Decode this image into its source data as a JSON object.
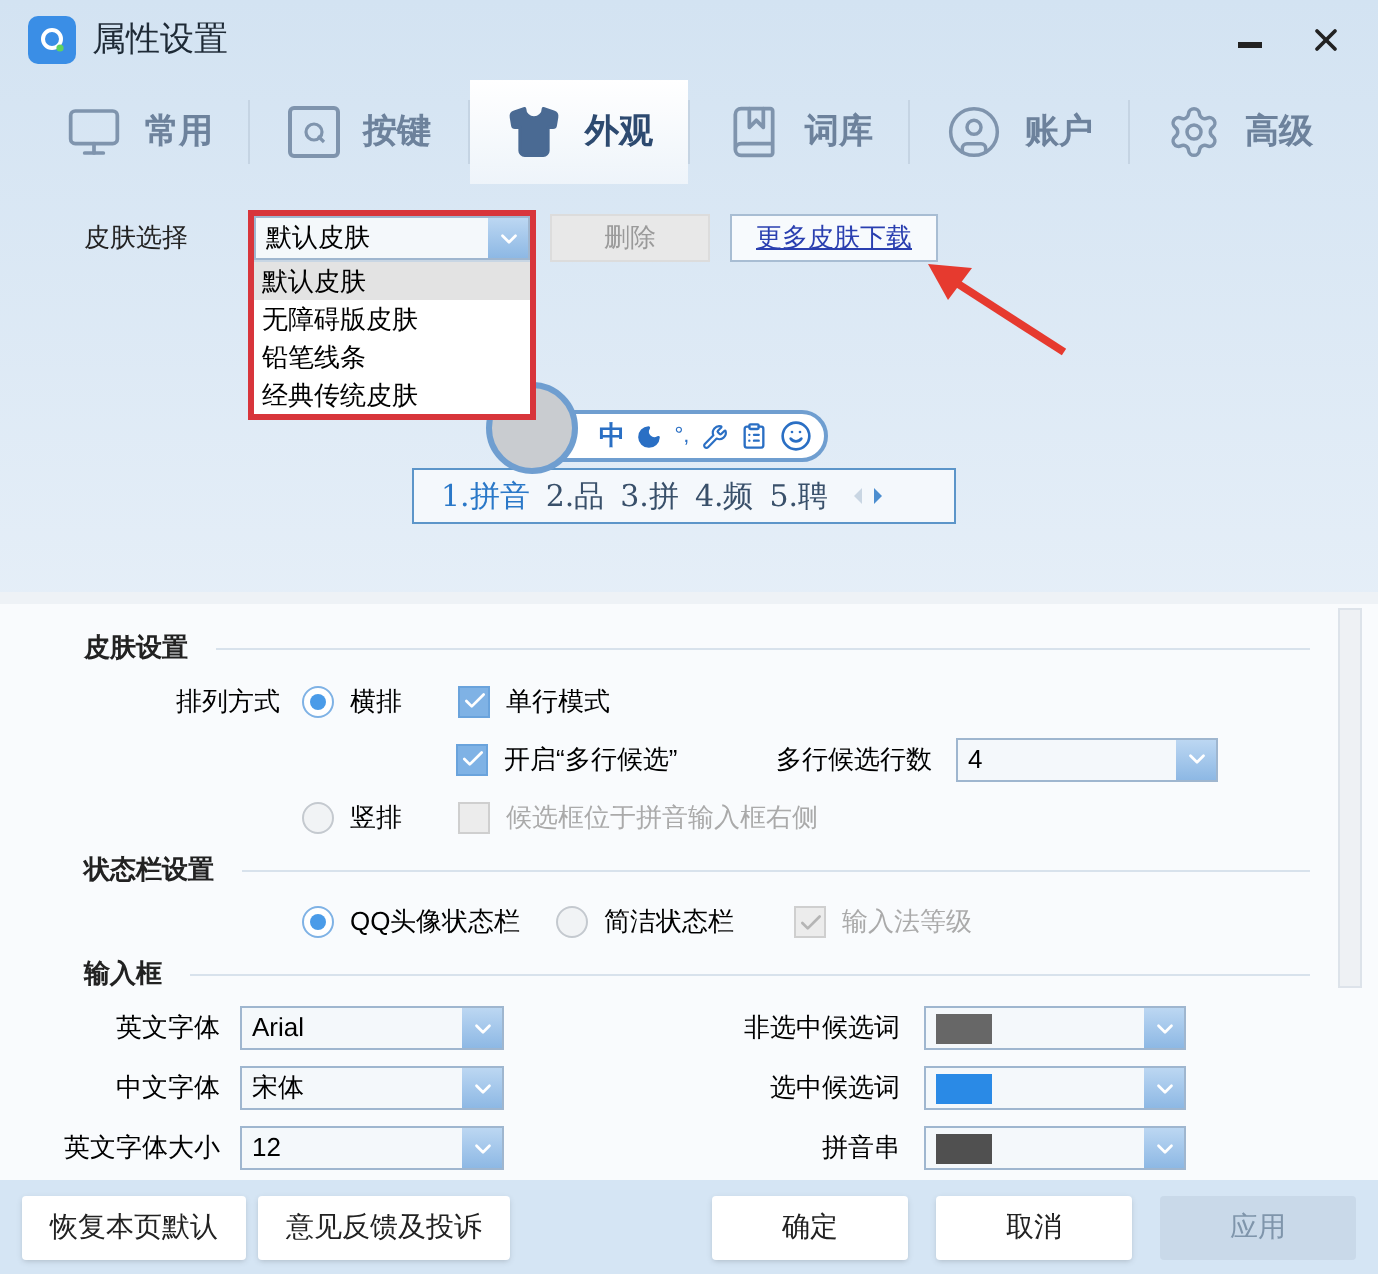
{
  "window": {
    "title": "属性设置"
  },
  "tabs": [
    {
      "label": "常用",
      "selected": false
    },
    {
      "label": "按键",
      "selected": false
    },
    {
      "label": "外观",
      "selected": true
    },
    {
      "label": "词库",
      "selected": false
    },
    {
      "label": "账户",
      "selected": false
    },
    {
      "label": "高级",
      "selected": false
    }
  ],
  "skin_select": {
    "label": "皮肤选择",
    "value": "默认皮肤",
    "expanded": true,
    "options": [
      {
        "label": "默认皮肤",
        "selected": true
      },
      {
        "label": "无障碍版皮肤",
        "selected": false
      },
      {
        "label": "铅笔线条",
        "selected": false
      },
      {
        "label": "经典传统皮肤",
        "selected": false
      }
    ],
    "delete_button": {
      "label": "删除",
      "disabled": true
    },
    "more_link": "更多皮肤下载"
  },
  "preview": {
    "mode": "中",
    "punctuation": "°,",
    "candidates": [
      "1.拼音",
      "2.品",
      "3.拼",
      "4.频",
      "5.聘"
    ]
  },
  "skin_settings": {
    "title": "皮肤设置",
    "layout_label": "排列方式",
    "horizontal": {
      "label": "横排",
      "selected": true
    },
    "single_line": {
      "label": "单行模式",
      "checked": true,
      "disabled": false
    },
    "multi_line": {
      "label": "开启“多行候选”",
      "checked": true,
      "disabled": false
    },
    "rows_label": "多行候选行数",
    "rows_value": "4",
    "vertical": {
      "label": "竖排",
      "selected": false
    },
    "right_side": {
      "label": "候选框位于拼音输入框右侧",
      "checked": false,
      "disabled": true
    }
  },
  "statusbar_settings": {
    "title": "状态栏设置",
    "options": [
      {
        "label": "QQ头像状态栏",
        "selected": true
      },
      {
        "label": "简洁状态栏",
        "selected": false
      }
    ],
    "level_check": {
      "label": "输入法等级",
      "checked": true,
      "disabled": true
    }
  },
  "input_box": {
    "title": "输入框",
    "fonts": [
      {
        "label": "英文字体",
        "value": "Arial"
      },
      {
        "label": "中文字体",
        "value": "宋体"
      },
      {
        "label": "英文字体大小",
        "value": "12"
      }
    ],
    "colors": [
      {
        "label": "非选中候选词",
        "color": "#676767"
      },
      {
        "label": "选中候选词",
        "color": "#2a8ae6"
      },
      {
        "label": "拼音串",
        "color": "#505050"
      }
    ]
  },
  "buttons": [
    {
      "label": "恢复本页默认",
      "disabled": false
    },
    {
      "label": "意见反馈及投诉",
      "disabled": false
    },
    {
      "label": "确定",
      "disabled": false
    },
    {
      "label": "取消",
      "disabled": false
    },
    {
      "label": "应用",
      "disabled": true
    }
  ]
}
